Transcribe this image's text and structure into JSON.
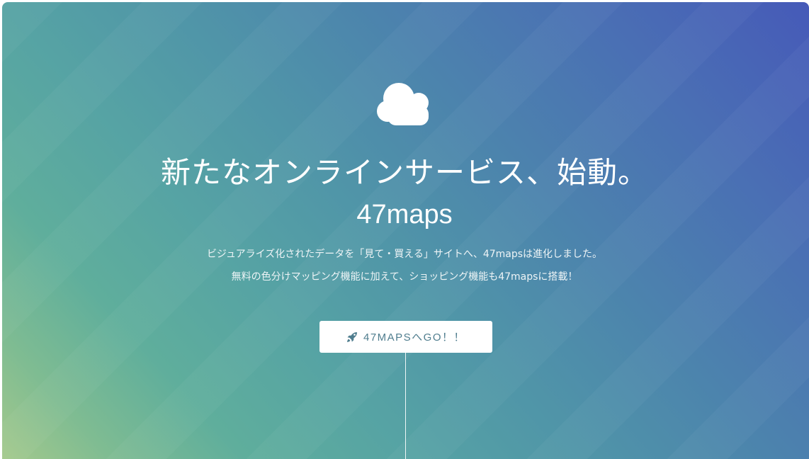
{
  "hero": {
    "icon": "cloud-icon",
    "headline": "新たなオンラインサービス、始動。",
    "brand": "47maps",
    "description_line1": "ビジュアライズ化されたデータを「見て・買える」サイトへ、47mapsは進化しました。",
    "description_line2": "無料の色分けマッピング機能に加えて、ショッピング機能も47mapsに搭載！",
    "cta": {
      "icon": "rocket-icon",
      "label": "47MAPSへGO！！"
    }
  },
  "colors": {
    "gradient_start": "#a4c98c",
    "gradient_mid": "#56a3a4",
    "gradient_end": "#465ab8",
    "button_text": "#4f7d8e"
  }
}
